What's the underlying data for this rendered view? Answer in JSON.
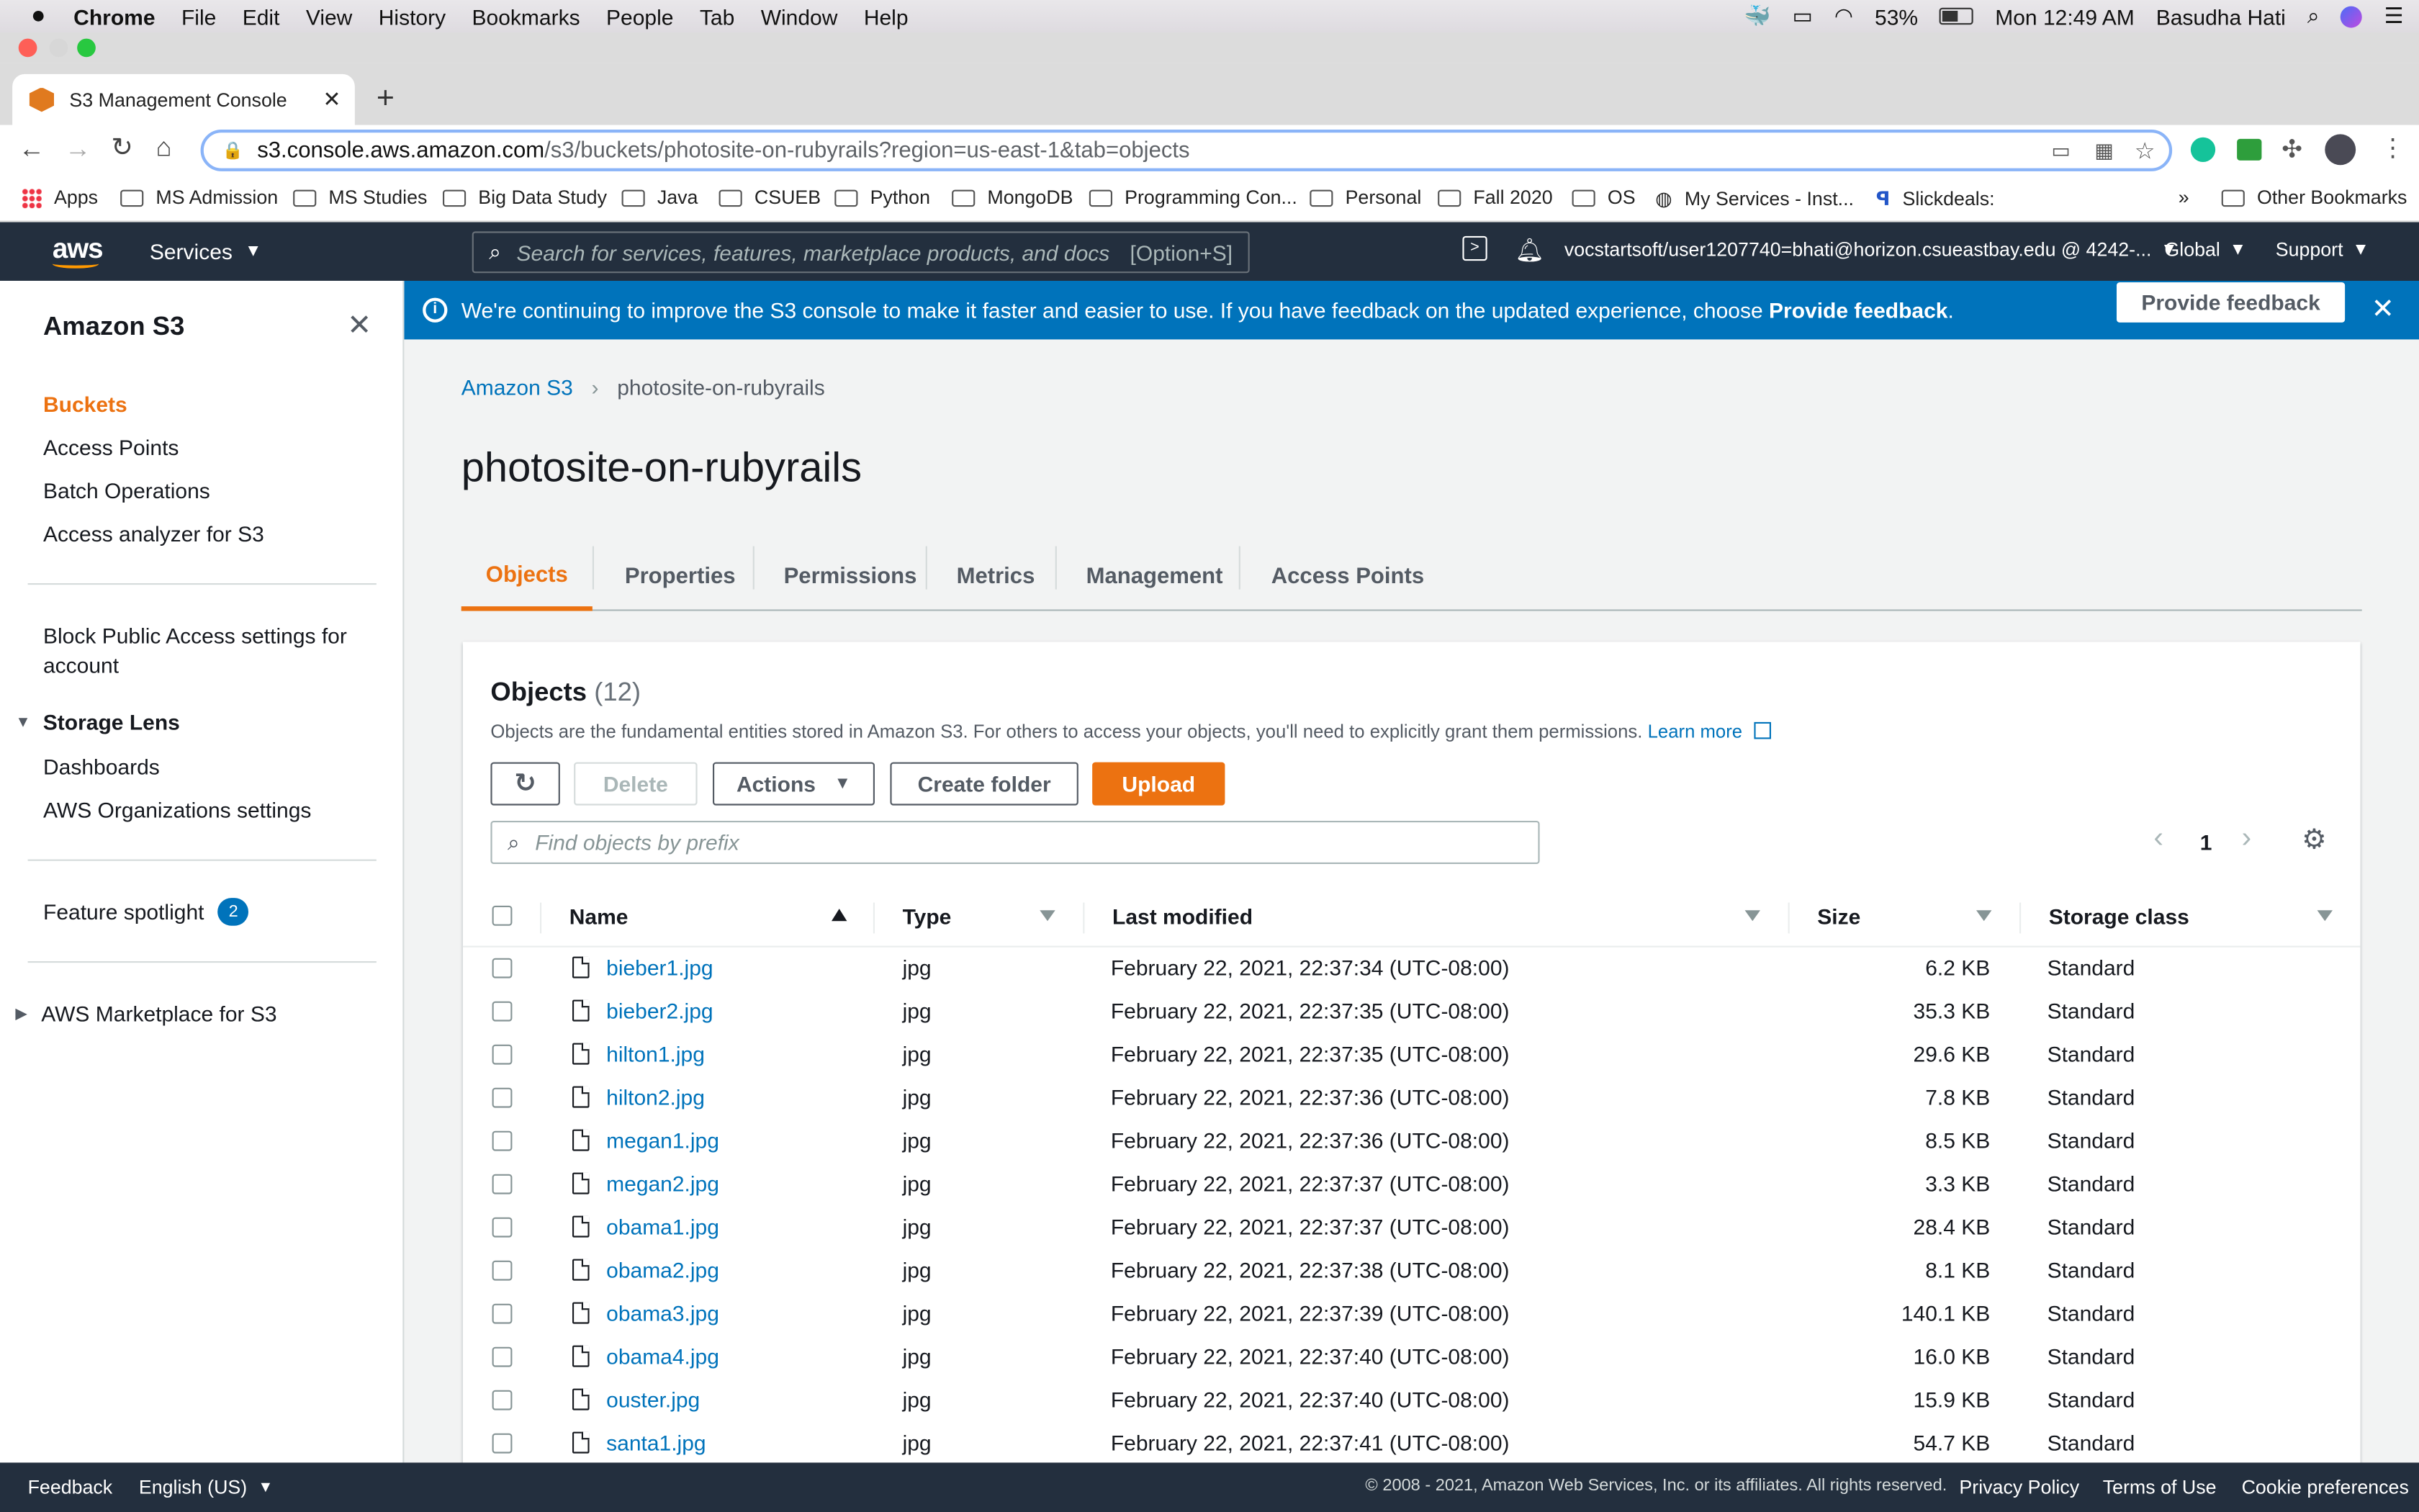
{
  "menubar": {
    "app": "Chrome",
    "items": [
      "File",
      "Edit",
      "View",
      "History",
      "Bookmarks",
      "People",
      "Tab",
      "Window",
      "Help"
    ],
    "battery": "53%",
    "clock": "Mon 12:49 AM",
    "user": "Basudha Hati"
  },
  "browser": {
    "tab_title": "S3 Management Console",
    "url_host": "s3.console.aws.amazon.com",
    "url_path": "/s3/buckets/photosite-on-rubyrails?region=us-east-1&tab=objects",
    "bookmarks": [
      "Apps",
      "MS Admission",
      "MS Studies",
      "Big Data Study",
      "Java",
      "CSUEB",
      "Python",
      "MongoDB",
      "Programming Con...",
      "Personal",
      "Fall 2020",
      "OS",
      "My Services - Inst...",
      "Slickdeals:"
    ],
    "overflow": "»",
    "other_bookmarks": "Other Bookmarks"
  },
  "aws_header": {
    "logo": "aws",
    "services": "Services",
    "search_placeholder": "Search for services, features, marketplace products, and docs",
    "search_shortcut": "[Option+S]",
    "account": "vocstartsoft/user1207740=bhati@horizon.csueastbay.edu @ 4242-...",
    "region": "Global",
    "support": "Support"
  },
  "banner": {
    "text": "We're continuing to improve the S3 console to make it faster and easier to use. If you have feedback on the updated experience, choose",
    "link": "Provide feedback",
    "tail": ".",
    "button": "Provide feedback"
  },
  "sidebar": {
    "title": "Amazon S3",
    "items": [
      "Buckets",
      "Access Points",
      "Batch Operations",
      "Access analyzer for S3"
    ],
    "block_public_1": "Block Public Access settings for",
    "block_public_2": "account",
    "storage_lens": "Storage Lens",
    "lens_items": [
      "Dashboards",
      "AWS Organizations settings"
    ],
    "feature_spotlight": "Feature spotlight",
    "feature_count": "2",
    "marketplace": "AWS Marketplace for S3"
  },
  "breadcrumb": {
    "root": "Amazon S3",
    "current": "photosite-on-rubyrails"
  },
  "page_title": "photosite-on-rubyrails",
  "tabs": [
    "Objects",
    "Properties",
    "Permissions",
    "Metrics",
    "Management",
    "Access Points"
  ],
  "objects": {
    "title": "Objects",
    "count": "(12)",
    "description": "Objects are the fundamental entities stored in Amazon S3. For others to access your objects, you'll need to explicitly grant them permissions.",
    "learn_more": "Learn more",
    "buttons": {
      "delete": "Delete",
      "actions": "Actions",
      "create_folder": "Create folder",
      "upload": "Upload"
    },
    "filter_placeholder": "Find objects by prefix",
    "page": "1",
    "columns": [
      "Name",
      "Type",
      "Last modified",
      "Size",
      "Storage class"
    ],
    "rows": [
      {
        "name": "bieber1.jpg",
        "type": "jpg",
        "modified": "February 22, 2021, 22:37:34 (UTC-08:00)",
        "size": "6.2 KB",
        "class": "Standard"
      },
      {
        "name": "bieber2.jpg",
        "type": "jpg",
        "modified": "February 22, 2021, 22:37:35 (UTC-08:00)",
        "size": "35.3 KB",
        "class": "Standard"
      },
      {
        "name": "hilton1.jpg",
        "type": "jpg",
        "modified": "February 22, 2021, 22:37:35 (UTC-08:00)",
        "size": "29.6 KB",
        "class": "Standard"
      },
      {
        "name": "hilton2.jpg",
        "type": "jpg",
        "modified": "February 22, 2021, 22:37:36 (UTC-08:00)",
        "size": "7.8 KB",
        "class": "Standard"
      },
      {
        "name": "megan1.jpg",
        "type": "jpg",
        "modified": "February 22, 2021, 22:37:36 (UTC-08:00)",
        "size": "8.5 KB",
        "class": "Standard"
      },
      {
        "name": "megan2.jpg",
        "type": "jpg",
        "modified": "February 22, 2021, 22:37:37 (UTC-08:00)",
        "size": "3.3 KB",
        "class": "Standard"
      },
      {
        "name": "obama1.jpg",
        "type": "jpg",
        "modified": "February 22, 2021, 22:37:37 (UTC-08:00)",
        "size": "28.4 KB",
        "class": "Standard"
      },
      {
        "name": "obama2.jpg",
        "type": "jpg",
        "modified": "February 22, 2021, 22:37:38 (UTC-08:00)",
        "size": "8.1 KB",
        "class": "Standard"
      },
      {
        "name": "obama3.jpg",
        "type": "jpg",
        "modified": "February 22, 2021, 22:37:39 (UTC-08:00)",
        "size": "140.1 KB",
        "class": "Standard"
      },
      {
        "name": "obama4.jpg",
        "type": "jpg",
        "modified": "February 22, 2021, 22:37:40 (UTC-08:00)",
        "size": "16.0 KB",
        "class": "Standard"
      },
      {
        "name": "ouster.jpg",
        "type": "jpg",
        "modified": "February 22, 2021, 22:37:40 (UTC-08:00)",
        "size": "15.9 KB",
        "class": "Standard"
      },
      {
        "name": "santa1.jpg",
        "type": "jpg",
        "modified": "February 22, 2021, 22:37:41 (UTC-08:00)",
        "size": "54.7 KB",
        "class": "Standard"
      }
    ]
  },
  "footer": {
    "feedback": "Feedback",
    "language": "English (US)",
    "copyright": "© 2008 - 2021, Amazon Web Services, Inc. or its affiliates. All rights reserved.",
    "links": [
      "Privacy Policy",
      "Terms of Use",
      "Cookie preferences"
    ]
  },
  "colors": {
    "aws_nav": "#232f3e",
    "banner": "#0073bb",
    "accent_orange": "#ec7211",
    "link": "#0073bb"
  }
}
